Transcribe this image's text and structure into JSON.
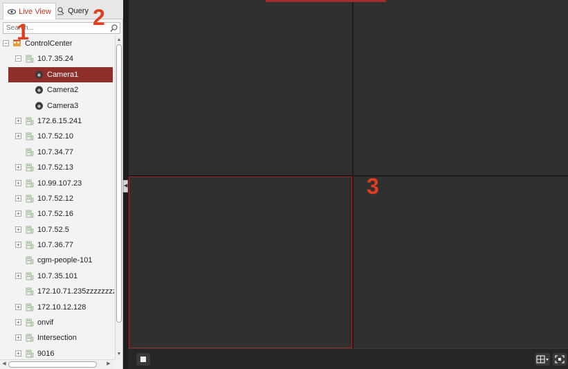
{
  "tabs": {
    "live_view": "Live View",
    "query": "Query"
  },
  "search": {
    "placeholder": "Search..."
  },
  "tree": [
    {
      "label": "ControlCenter",
      "level": 0,
      "expander": "minus",
      "icon": "control-center-icon"
    },
    {
      "label": "10.7.35.24",
      "level": 1,
      "expander": "minus",
      "icon": "building-icon"
    },
    {
      "label": "Camera1",
      "level": 2,
      "expander": "none",
      "icon": "camera-icon",
      "selected": true
    },
    {
      "label": "Camera2",
      "level": 2,
      "expander": "none",
      "icon": "camera-icon"
    },
    {
      "label": "Camera3",
      "level": 2,
      "expander": "none",
      "icon": "camera-icon"
    },
    {
      "label": "172.6.15.241",
      "level": 1,
      "expander": "plus",
      "icon": "building-icon"
    },
    {
      "label": "10.7.52.10",
      "level": 1,
      "expander": "plus",
      "icon": "building-icon"
    },
    {
      "label": "10.7.34.77",
      "level": 1,
      "expander": "none",
      "icon": "building-icon"
    },
    {
      "label": "10.7.52.13",
      "level": 1,
      "expander": "plus",
      "icon": "building-icon"
    },
    {
      "label": "10.99.107.23",
      "level": 1,
      "expander": "plus",
      "icon": "building-icon"
    },
    {
      "label": "10.7.52.12",
      "level": 1,
      "expander": "plus",
      "icon": "building-icon"
    },
    {
      "label": "10.7.52.16",
      "level": 1,
      "expander": "plus",
      "icon": "building-icon"
    },
    {
      "label": "10.7.52.5",
      "level": 1,
      "expander": "plus",
      "icon": "building-icon"
    },
    {
      "label": "10.7.36.77",
      "level": 1,
      "expander": "plus",
      "icon": "building-icon"
    },
    {
      "label": "cgm-people-101",
      "level": 1,
      "expander": "none",
      "icon": "building-icon"
    },
    {
      "label": "10.7.35.101",
      "level": 1,
      "expander": "plus",
      "icon": "building-icon"
    },
    {
      "label": "172.10.71.235zzzzzzzz",
      "level": 1,
      "expander": "none",
      "icon": "building-icon"
    },
    {
      "label": "172.10.12.128",
      "level": 1,
      "expander": "plus",
      "icon": "building-icon"
    },
    {
      "label": "onvif",
      "level": 1,
      "expander": "plus",
      "icon": "building-icon"
    },
    {
      "label": "Intersection",
      "level": 1,
      "expander": "plus",
      "icon": "building-icon"
    },
    {
      "label": "9016",
      "level": 1,
      "expander": "plus",
      "icon": "building-icon"
    }
  ],
  "annotations": {
    "one": "1",
    "two": "2",
    "three": "3"
  },
  "colors": {
    "accent": "#c0392b",
    "selected_row": "#8e2f2a",
    "annotation": "#e23d1d",
    "pane_bg": "#303030",
    "active_pane_border": "#9a2b2b"
  }
}
